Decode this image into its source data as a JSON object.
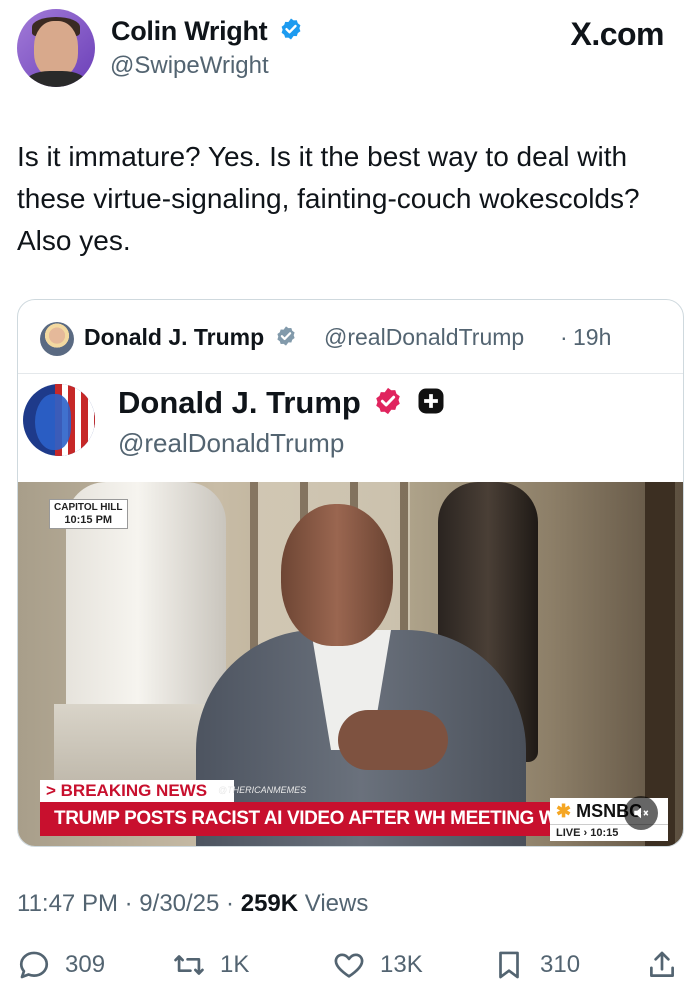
{
  "author": {
    "name": "Colin Wright",
    "handle": "@SwipeWright"
  },
  "site_label": "X.com",
  "tweet_text": "Is it immature? Yes. Is it the best way to deal with these virtue-signaling, fainting-couch wokescolds? Also yes.",
  "quote": {
    "name": "Donald J. Trump",
    "handle": "@realDonaldTrump",
    "separator": "·",
    "age": "19h",
    "post": {
      "name": "Donald J. Trump",
      "handle": "@realDonaldTrump"
    },
    "video": {
      "location_tag": "CAPITOL HILL",
      "time_tag": "10:15 PM",
      "breaking_label": "> BREAKING NEWS",
      "watermark": "@THERICANMEMES",
      "headline": "TRUMP POSTS RACIST AI VIDEO AFTER WH MEETING W/ DEMS",
      "network": "MSNBC",
      "live_text": "LIVE › 10:15"
    }
  },
  "meta": {
    "time": "11:47 PM",
    "date": "9/30/25",
    "views_count": "259K",
    "views_label": "Views",
    "dot": "·"
  },
  "actions": {
    "replies": "309",
    "reposts": "1K",
    "likes": "13K",
    "bookmarks": "310"
  },
  "colors": {
    "verified_blue": "#1d9bf0",
    "verified_gray": "#829aab",
    "verified_pink": "#e0245e",
    "breaking_red": "#c8102e",
    "text_gray": "#536471"
  },
  "icons": [
    "verified-badge-icon",
    "reply-icon",
    "repost-icon",
    "like-icon",
    "bookmark-icon",
    "share-icon",
    "mute-icon",
    "truth-social-plus-icon"
  ]
}
